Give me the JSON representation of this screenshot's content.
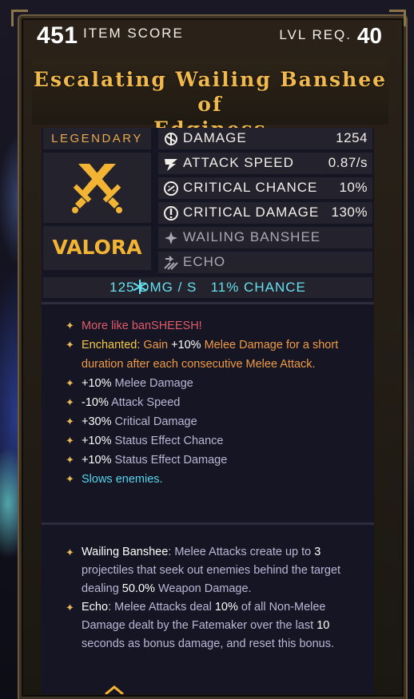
{
  "header": {
    "item_score_value": "451",
    "item_score_label": "ITEM SCORE",
    "level_req_label": "LVL REQ.",
    "level_req_value": "40"
  },
  "item": {
    "title_line1": "Escalating Wailing Banshee of",
    "title_line2": "Edginess",
    "rarity": "LEGENDARY",
    "brand": "VALORA",
    "weapon_icon": "crossed-swords-icon"
  },
  "stats": [
    {
      "icon": "damage-icon",
      "label": "DAMAGE",
      "value": "1254"
    },
    {
      "icon": "attack-speed-icon",
      "label": "ATTACK SPEED",
      "value": "0.87/s"
    },
    {
      "icon": "critical-chance-icon",
      "label": "CRITICAL CHANCE",
      "value": "10%"
    },
    {
      "icon": "critical-damage-icon",
      "label": "CRITICAL DAMAGE",
      "value": "130%"
    },
    {
      "icon": "sparkle-icon",
      "label": "WAILING BANSHEE",
      "value": ""
    },
    {
      "icon": "echo-icon",
      "label": "ECHO",
      "value": ""
    }
  ],
  "status_effect": {
    "icon": "snowflake-icon",
    "text": "125 DMG / S   11% CHANCE"
  },
  "traits": {
    "flavor": "More like banSHEESH!",
    "enchanted_label": "Enchanted:",
    "enchanted_pre": " Gain ",
    "enchanted_value": "+10%",
    "enchanted_post": " Melee Damage for a short duration after each consecutive Melee Attack.",
    "modifiers": [
      {
        "value": "+10%",
        "text": " Melee Damage"
      },
      {
        "value": "-10%",
        "text": " Attack Speed"
      },
      {
        "value": "+30%",
        "text": " Critical Damage"
      },
      {
        "value": "+10%",
        "text": " Status Effect Chance"
      },
      {
        "value": "+10%",
        "text": " Status Effect Damage"
      }
    ],
    "slows": "Slows enemies."
  },
  "abilities": {
    "banshee_name": "Wailing Banshee",
    "banshee_t1": ": Melee Attacks create up to ",
    "banshee_n1": "3",
    "banshee_t2": " projectiles that seek out enemies behind the target dealing ",
    "banshee_n2": "50.0%",
    "banshee_t3": " Weapon Damage.",
    "echo_name": "Echo",
    "echo_t1": ": Melee Attacks deal ",
    "echo_n1": "10%",
    "echo_t2": " of all Non-Melee Damage dealt by the Fatemaker over the last ",
    "echo_n2": "10",
    "echo_t3": " seconds as bonus damage, and reset this bonus."
  },
  "colors": {
    "title_gold": "#f0b84d",
    "rarity_orange": "#eaa94a",
    "status_cyan": "#66e0ee",
    "flavor_pink": "#e05c6b",
    "enchant_orange": "#f09b45",
    "panel": "#151523"
  }
}
